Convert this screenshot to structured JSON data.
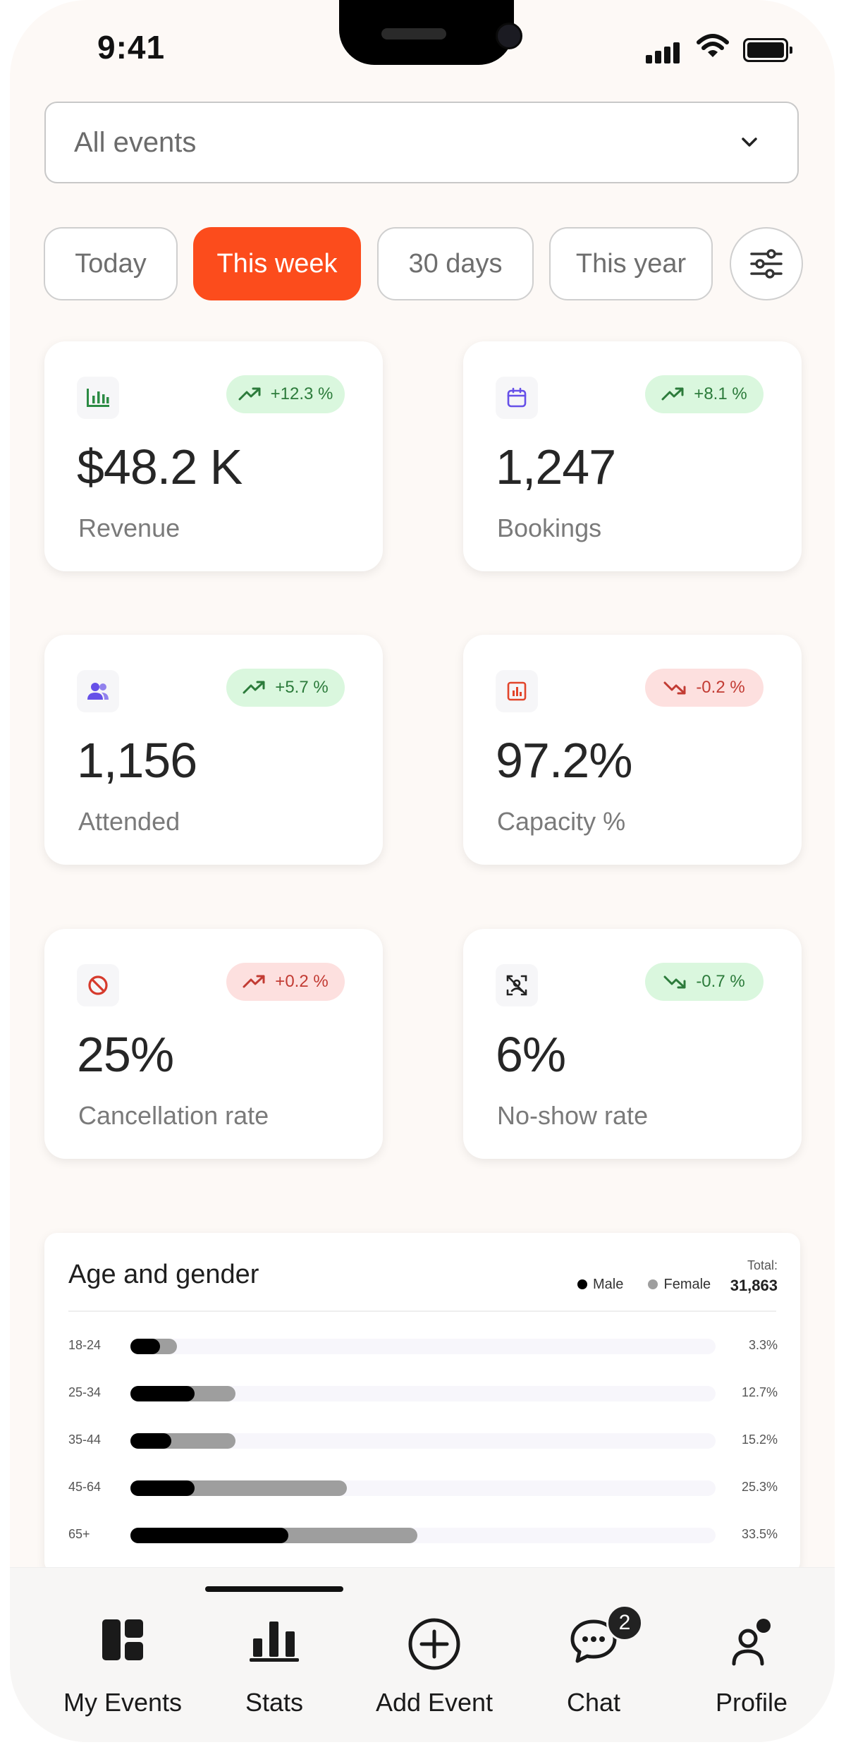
{
  "status_bar": {
    "time": "9:41"
  },
  "event_filter": {
    "selected": "All events"
  },
  "periods": [
    "Today",
    "This week",
    "30 days",
    "This year"
  ],
  "active_period": "This week",
  "stats": [
    {
      "label": "Revenue",
      "value": "$48.2 K",
      "change": "+12.3 %",
      "trend": "up",
      "tone": "positive",
      "icon": "bar-chart-icon"
    },
    {
      "label": "Bookings",
      "value": "1,247",
      "change": "+8.1 %",
      "trend": "up",
      "tone": "positive",
      "icon": "calendar-icon"
    },
    {
      "label": "Attended",
      "value": "1,156",
      "change": "+5.7 %",
      "trend": "up",
      "tone": "positive",
      "icon": "users-icon"
    },
    {
      "label": "Capacity %",
      "value": "97.2%",
      "change": "-0.2 %",
      "trend": "down",
      "tone": "negative",
      "icon": "chart-box-icon"
    },
    {
      "label": "Cancellation rate",
      "value": "25%",
      "change": "+0.2 %",
      "trend": "up",
      "tone": "negative",
      "icon": "ban-icon"
    },
    {
      "label": "No-show rate",
      "value": "6%",
      "change": "-0.7 %",
      "trend": "down",
      "tone": "positive",
      "icon": "no-user-icon"
    }
  ],
  "age_gender": {
    "title": "Age and gender",
    "legend": {
      "male": "Male",
      "female": "Female"
    },
    "total_label": "Total:",
    "total_value": "31,863"
  },
  "chart_data": {
    "type": "bar",
    "title": "Age and gender",
    "categories": [
      "18-24",
      "25-34",
      "35-44",
      "45-64",
      "65+"
    ],
    "percent_labels": [
      "3.3%",
      "12.7%",
      "15.2%",
      "25.3%",
      "33.5%"
    ],
    "series": [
      {
        "name": "Male",
        "values": [
          5,
          11,
          7,
          11,
          27
        ]
      },
      {
        "name": "Female",
        "values": [
          3,
          7,
          11,
          26,
          22
        ]
      }
    ],
    "colors": {
      "male": "#000000",
      "female": "#9e9e9e",
      "track": "#f7f6fb"
    },
    "xlim": [
      0,
      100
    ],
    "legend_position": "top-right"
  },
  "tabs": [
    {
      "label": "My Events",
      "icon": "dashboard-icon"
    },
    {
      "label": "Stats",
      "icon": "stats-icon"
    },
    {
      "label": "Add Event",
      "icon": "add-circle-icon"
    },
    {
      "label": "Chat",
      "icon": "chat-icon",
      "badge": "2"
    },
    {
      "label": "Profile",
      "icon": "profile-icon"
    }
  ],
  "active_tab": "Stats",
  "colors": {
    "accent": "#fc4c1c",
    "positive_bg": "#daf7de",
    "positive_fg": "#2c7b3b",
    "negative_bg": "#fde0df",
    "negative_fg": "#c23b33"
  }
}
